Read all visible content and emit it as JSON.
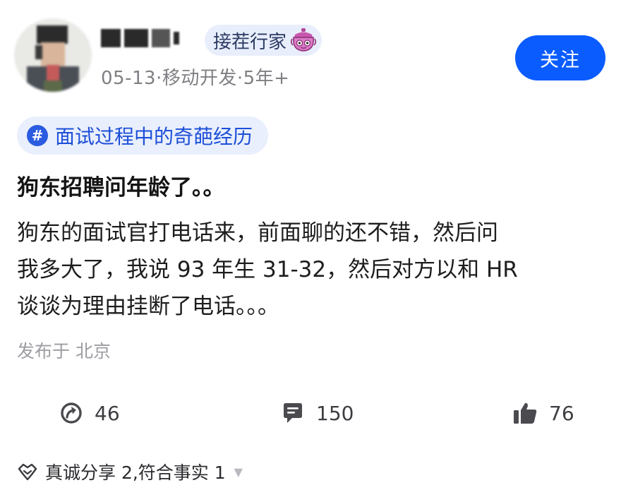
{
  "author": {
    "name": "",
    "badge_label": "接茬行家",
    "meta": "05-13·移动开发·5年+",
    "follow_label": "关注"
  },
  "post": {
    "topic_tag": "面试过程中的奇葩经历",
    "title": "狗东招聘问年龄了。。",
    "body_lines": [
      "狗东的面试官打电话来，前面聊的还不错，然后问",
      "我多大了，我说 93 年生 31-32，然后对方以和 HR",
      "谈谈为理由挂断了电话。。。"
    ],
    "location": "发布于 北京"
  },
  "actions": {
    "share_count": "46",
    "comment_count": "150",
    "like_count": "76"
  },
  "footer": {
    "text": "真诚分享 2,符合事实 1"
  },
  "colors": {
    "primary_blue": "#0a5cff",
    "tag_bg": "#e9effc",
    "tag_text": "#1d4fd8",
    "meta_gray": "#7f7f84"
  }
}
